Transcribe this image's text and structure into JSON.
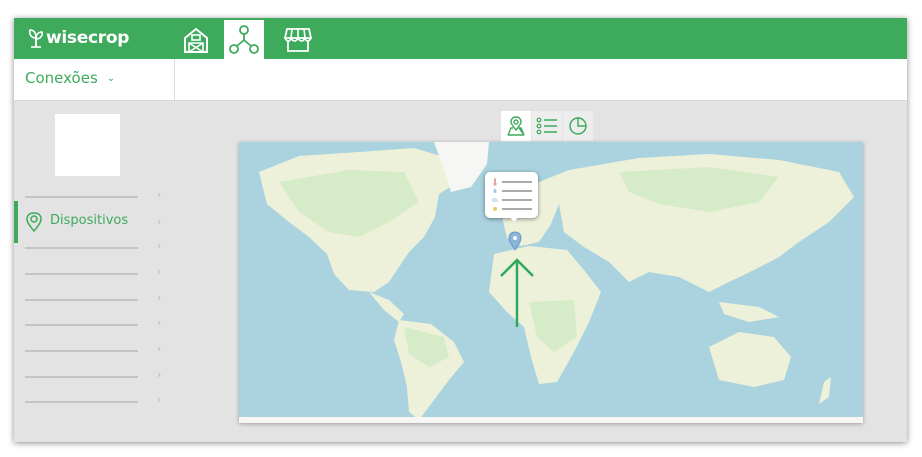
{
  "app": {
    "brand": "wisecrop"
  },
  "nav": {
    "buttons": [
      {
        "icon": "farm-icon",
        "active": false
      },
      {
        "icon": "connections-icon",
        "active": true
      },
      {
        "icon": "market-icon",
        "active": false
      }
    ]
  },
  "section": {
    "title": "Conexões",
    "chevron": "⌄"
  },
  "sidebar": {
    "active_item": {
      "label": "Dispositivos",
      "icon": "location-pin-icon"
    },
    "chevron": "›"
  },
  "view_tabs": [
    {
      "icon": "map-pin-icon",
      "active": true
    },
    {
      "icon": "list-icon",
      "active": false
    },
    {
      "icon": "pie-chart-icon",
      "active": false
    }
  ],
  "colors": {
    "brand": "#3daa5c",
    "water": "#aad3df",
    "land": "#eef1da",
    "forest": "#d6ebc7"
  }
}
